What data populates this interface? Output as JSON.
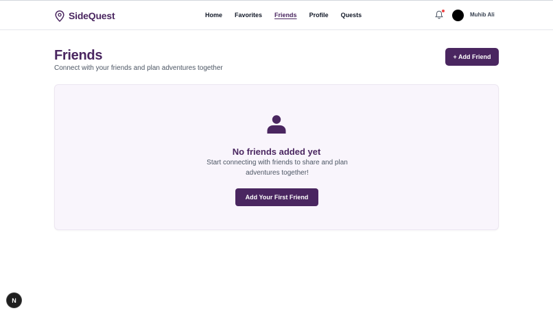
{
  "brand": {
    "name": "SideQuest",
    "icon": "map-pin-icon",
    "color": "#4a2660"
  },
  "nav": {
    "items": [
      {
        "label": "Home"
      },
      {
        "label": "Favorites"
      },
      {
        "label": "Friends",
        "active": true
      },
      {
        "label": "Profile"
      },
      {
        "label": "Quests"
      }
    ]
  },
  "user": {
    "name": "Muhib Ali",
    "has_notification": true
  },
  "page": {
    "title": "Friends",
    "subtitle": "Connect with your friends and plan adventures together",
    "add_button": "+ Add Friend"
  },
  "empty_state": {
    "icon": "person-icon",
    "title": "No friends added yet",
    "description": "Start connecting with friends to share and plan adventures together!",
    "button": "Add Your First Friend"
  },
  "badge": {
    "label": "N"
  }
}
